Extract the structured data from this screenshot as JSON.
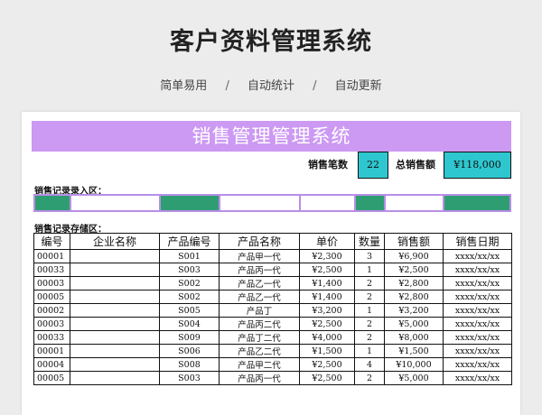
{
  "page": {
    "title": "客户资料管理系统",
    "features": [
      "简单易用",
      "自动统计",
      "自动更新"
    ],
    "separator": "/"
  },
  "sheet": {
    "banner": "销售管理管理系统",
    "stats": {
      "count_label": "销售笔数",
      "count_value": "22",
      "total_label": "总销售额",
      "total_value": "¥118,000"
    },
    "entry_section_label": "销售记录录入区：",
    "entry_cells": [
      "green",
      "white",
      "green",
      "white",
      "white",
      "green",
      "white",
      "green"
    ],
    "storage_section_label": "销售记录存储区：",
    "columns": [
      "编号",
      "企业名称",
      "产品编号",
      "产品名称",
      "单价",
      "数量",
      "销售额",
      "销售日期"
    ],
    "rows": [
      [
        "00001",
        "",
        "S001",
        "产品甲一代",
        "¥2,300",
        "3",
        "¥6,900",
        "xxxx/xx/xx"
      ],
      [
        "00033",
        "",
        "S003",
        "产品丙一代",
        "¥2,500",
        "1",
        "¥2,500",
        "xxxx/xx/xx"
      ],
      [
        "00003",
        "",
        "S002",
        "产品乙一代",
        "¥1,400",
        "2",
        "¥2,800",
        "xxxx/xx/xx"
      ],
      [
        "00005",
        "",
        "S002",
        "产品乙一代",
        "¥1,400",
        "2",
        "¥2,800",
        "xxxx/xx/xx"
      ],
      [
        "00002",
        "",
        "S005",
        "产品丁",
        "¥3,200",
        "1",
        "¥3,200",
        "xxxx/xx/xx"
      ],
      [
        "00003",
        "",
        "S004",
        "产品丙二代",
        "¥2,500",
        "2",
        "¥5,000",
        "xxxx/xx/xx"
      ],
      [
        "00033",
        "",
        "S009",
        "产品丁二代",
        "¥4,000",
        "2",
        "¥8,000",
        "xxxx/xx/xx"
      ],
      [
        "00001",
        "",
        "S006",
        "产品乙二代",
        "¥1,500",
        "1",
        "¥1,500",
        "xxxx/xx/xx"
      ],
      [
        "00004",
        "",
        "S008",
        "产品甲二代",
        "¥2,500",
        "4",
        "¥10,000",
        "xxxx/xx/xx"
      ],
      [
        "00005",
        "",
        "S003",
        "产品丙一代",
        "¥2,500",
        "2",
        "¥5,000",
        "xxxx/xx/xx"
      ]
    ]
  },
  "colors": {
    "banner": "#cc99f3",
    "stat_box": "#2fc7cf",
    "entry_green": "#2e9e72",
    "entry_border": "#b98ee8"
  }
}
